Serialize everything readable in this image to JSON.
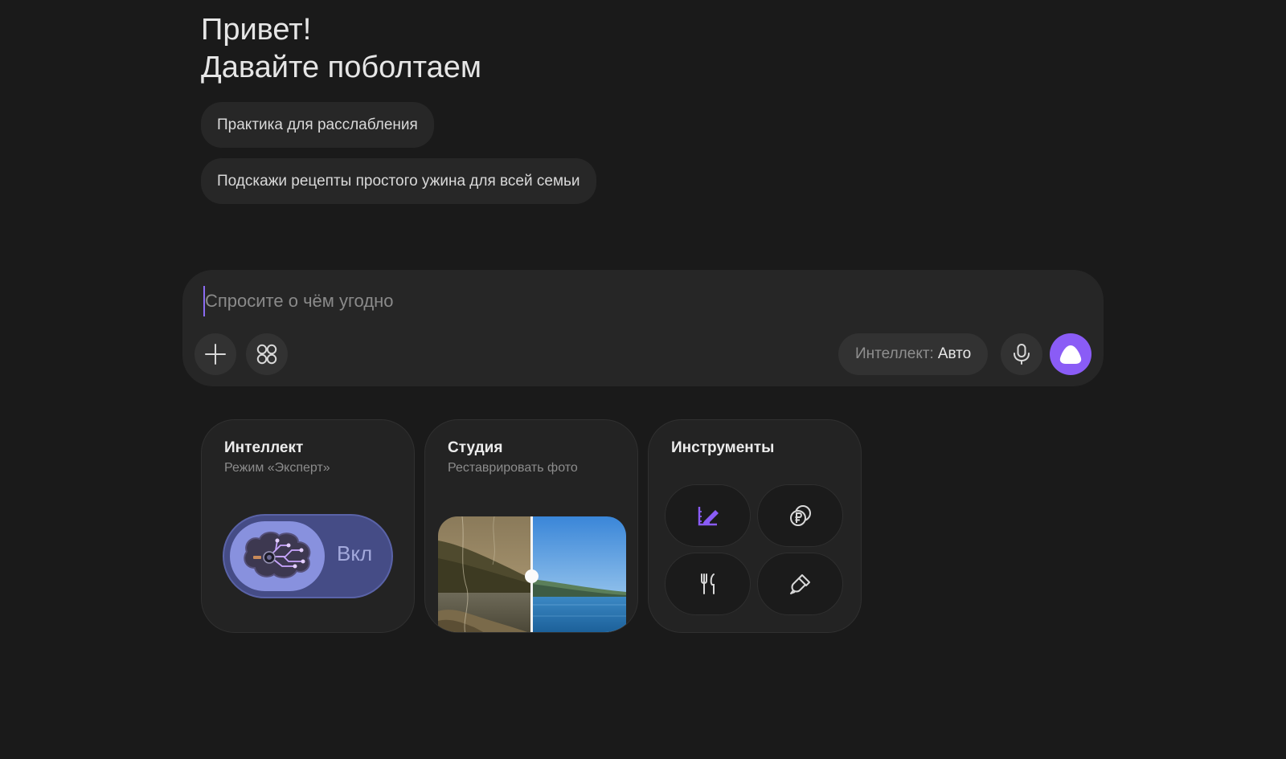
{
  "greeting": {
    "line1": "Привет!",
    "line2": "Давайте поболтаем"
  },
  "suggestions": [
    {
      "label": "Практика для расслабления"
    },
    {
      "label": "Подскажи рецепты простого ужина для всей семьи"
    }
  ],
  "composer": {
    "placeholder": "Спросите о чём угодно",
    "mode_label": "Интеллект:",
    "mode_value": "Авто",
    "buttons": {
      "attach": "plus-icon",
      "apps": "apps-grid-icon",
      "mic": "microphone-icon",
      "send": "assistant-logo-icon"
    }
  },
  "cards": {
    "intellect": {
      "title": "Интеллект",
      "subtitle": "Режим «Эксперт»",
      "toggle_label": "Вкл",
      "toggle_on": true
    },
    "studio": {
      "title": "Студия",
      "subtitle": "Реставрировать фото"
    },
    "tools": {
      "title": "Инструменты",
      "items": [
        "pen-ruler-icon",
        "ruble-coins-icon",
        "fork-knife-icon",
        "brush-icon"
      ]
    }
  },
  "colors": {
    "background": "#1a1a1a",
    "accent": "#8a5cf6",
    "toggle": "#454c86"
  }
}
